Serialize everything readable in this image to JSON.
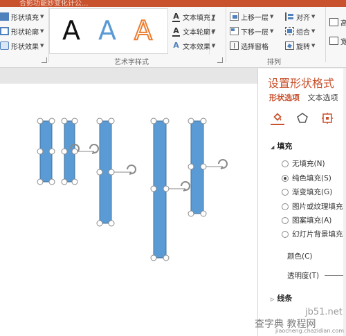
{
  "title_bar": {
    "text": "合影功能妙变化计公..."
  },
  "ribbon": {
    "shape_styles": {
      "fill_label": "形状填充",
      "outline_label": "形状轮廓",
      "effect_label": "形状效果"
    },
    "wordart": {
      "samples": [
        "A",
        "A",
        "A"
      ],
      "text_fill_label": "文本填充",
      "text_outline_label": "文本轮廓",
      "text_effect_label": "文本效果",
      "group_label": "艺术字样式"
    },
    "arrange": {
      "bring_forward_label": "上移一层",
      "send_backward_label": "下移一层",
      "selection_pane_label": "选择窗格",
      "align_label": "对齐",
      "group_label": "组合",
      "rotate_label": "旋转",
      "group_name": "排列"
    },
    "size": {
      "height_label": "高",
      "width_label": "宽"
    }
  },
  "format_pane": {
    "title": "设置形状格式",
    "tabs": [
      "形状选项",
      "文本选项"
    ],
    "section_fill": "填充",
    "fill_options": [
      {
        "label": "无填充(N)",
        "selected": false
      },
      {
        "label": "纯色填充(S)",
        "selected": true
      },
      {
        "label": "渐变填充(G)",
        "selected": false
      },
      {
        "label": "图片或纹理填充(",
        "selected": false
      },
      {
        "label": "图案填充(A)",
        "selected": false
      },
      {
        "label": "幻灯片背景填充(",
        "selected": false
      }
    ],
    "color_label": "颜色(C)",
    "transparency_label": "透明度(T)",
    "section_line": "线条"
  },
  "watermark": {
    "line1": "jb51.net",
    "line2": "查字典 教程网",
    "line3": "jiaocheng.chazidian.com"
  },
  "colors": {
    "accent": "#c9522e",
    "shape_fill": "#5b9bd5",
    "shape_border": "#41719c"
  }
}
